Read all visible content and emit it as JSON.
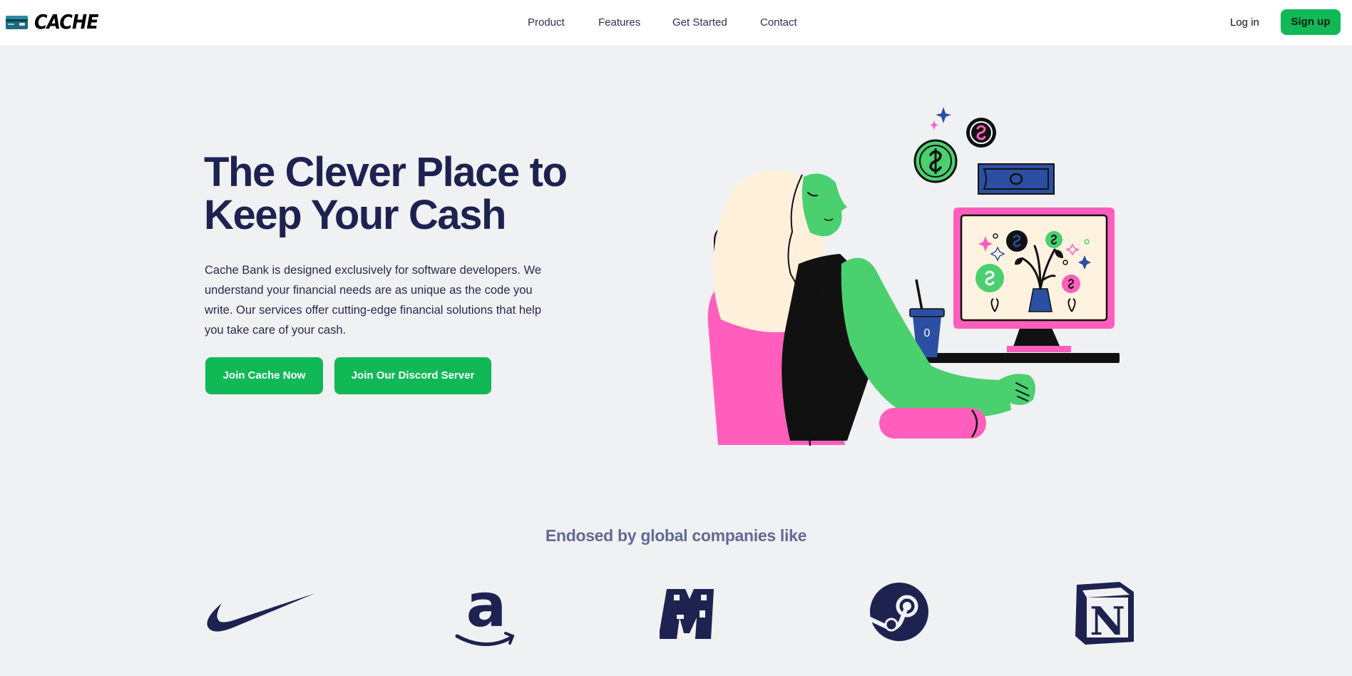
{
  "header": {
    "logo_text": "CACHE",
    "nav": [
      "Product",
      "Features",
      "Get Started",
      "Contact"
    ],
    "login_label": "Log in",
    "signup_label": "Sign up"
  },
  "hero": {
    "title": "The Clever Place to Keep Your Cash",
    "description": "Cache Bank is designed exclusively for software developers. We understand your financial needs are as unique as the code you write. Our services offer cutting-edge financial solutions that help you take care of your cash.",
    "primary_cta": "Join Cache Now",
    "secondary_cta": "Join Our Discord Server",
    "illustration_text": "0"
  },
  "endorsed": {
    "heading": "Endosed by global companies like",
    "logos": [
      "nike-icon",
      "amazon-icon",
      "minecraft-icon",
      "steam-icon",
      "notion-icon"
    ],
    "notion_letter": "N"
  },
  "colors": {
    "accent": "#10b956",
    "navy": "#1e2250",
    "pink": "#ff5ebc",
    "green_figure": "#4ad06f",
    "blue": "#2b4fa3",
    "background": "#f0f1f3"
  }
}
